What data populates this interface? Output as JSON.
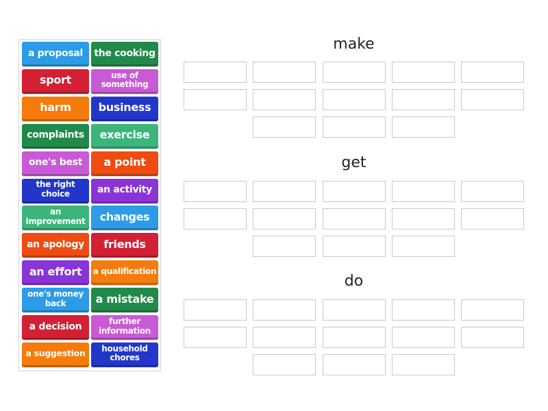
{
  "tiles": [
    {
      "label": "a proposal",
      "color": "#2c9be8"
    },
    {
      "label": "the cooking",
      "color": "#218a4a"
    },
    {
      "label": "sport",
      "color": "#d42034"
    },
    {
      "label": "use of something",
      "color": "#c95ad6"
    },
    {
      "label": "harm",
      "color": "#f57c0c"
    },
    {
      "label": "business",
      "color": "#2237c9"
    },
    {
      "label": "complaints",
      "color": "#218a4a"
    },
    {
      "label": "exercise",
      "color": "#3cb57c"
    },
    {
      "label": "one's best",
      "color": "#c95ad6"
    },
    {
      "label": "a point",
      "color": "#ee4c10"
    },
    {
      "label": "the right choice",
      "color": "#2237c9"
    },
    {
      "label": "an activity",
      "color": "#8a34d8"
    },
    {
      "label": "an improvement",
      "color": "#3cb57c"
    },
    {
      "label": "changes",
      "color": "#2c9be8"
    },
    {
      "label": "an apology",
      "color": "#ee4c10"
    },
    {
      "label": "friends",
      "color": "#d42034"
    },
    {
      "label": "an effort",
      "color": "#8a34d8"
    },
    {
      "label": "a qualification",
      "color": "#f57c0c"
    },
    {
      "label": "one's money back",
      "color": "#2c9be8"
    },
    {
      "label": "a mistake",
      "color": "#218a4a"
    },
    {
      "label": "a decision",
      "color": "#d42034"
    },
    {
      "label": "further information",
      "color": "#c95ad6"
    },
    {
      "label": "a suggestion",
      "color": "#f57c0c"
    },
    {
      "label": "household chores",
      "color": "#2237c9"
    }
  ],
  "groups": [
    {
      "title": "make",
      "slots": 13
    },
    {
      "title": "get",
      "slots": 13
    },
    {
      "title": "do",
      "slots": 13
    }
  ]
}
